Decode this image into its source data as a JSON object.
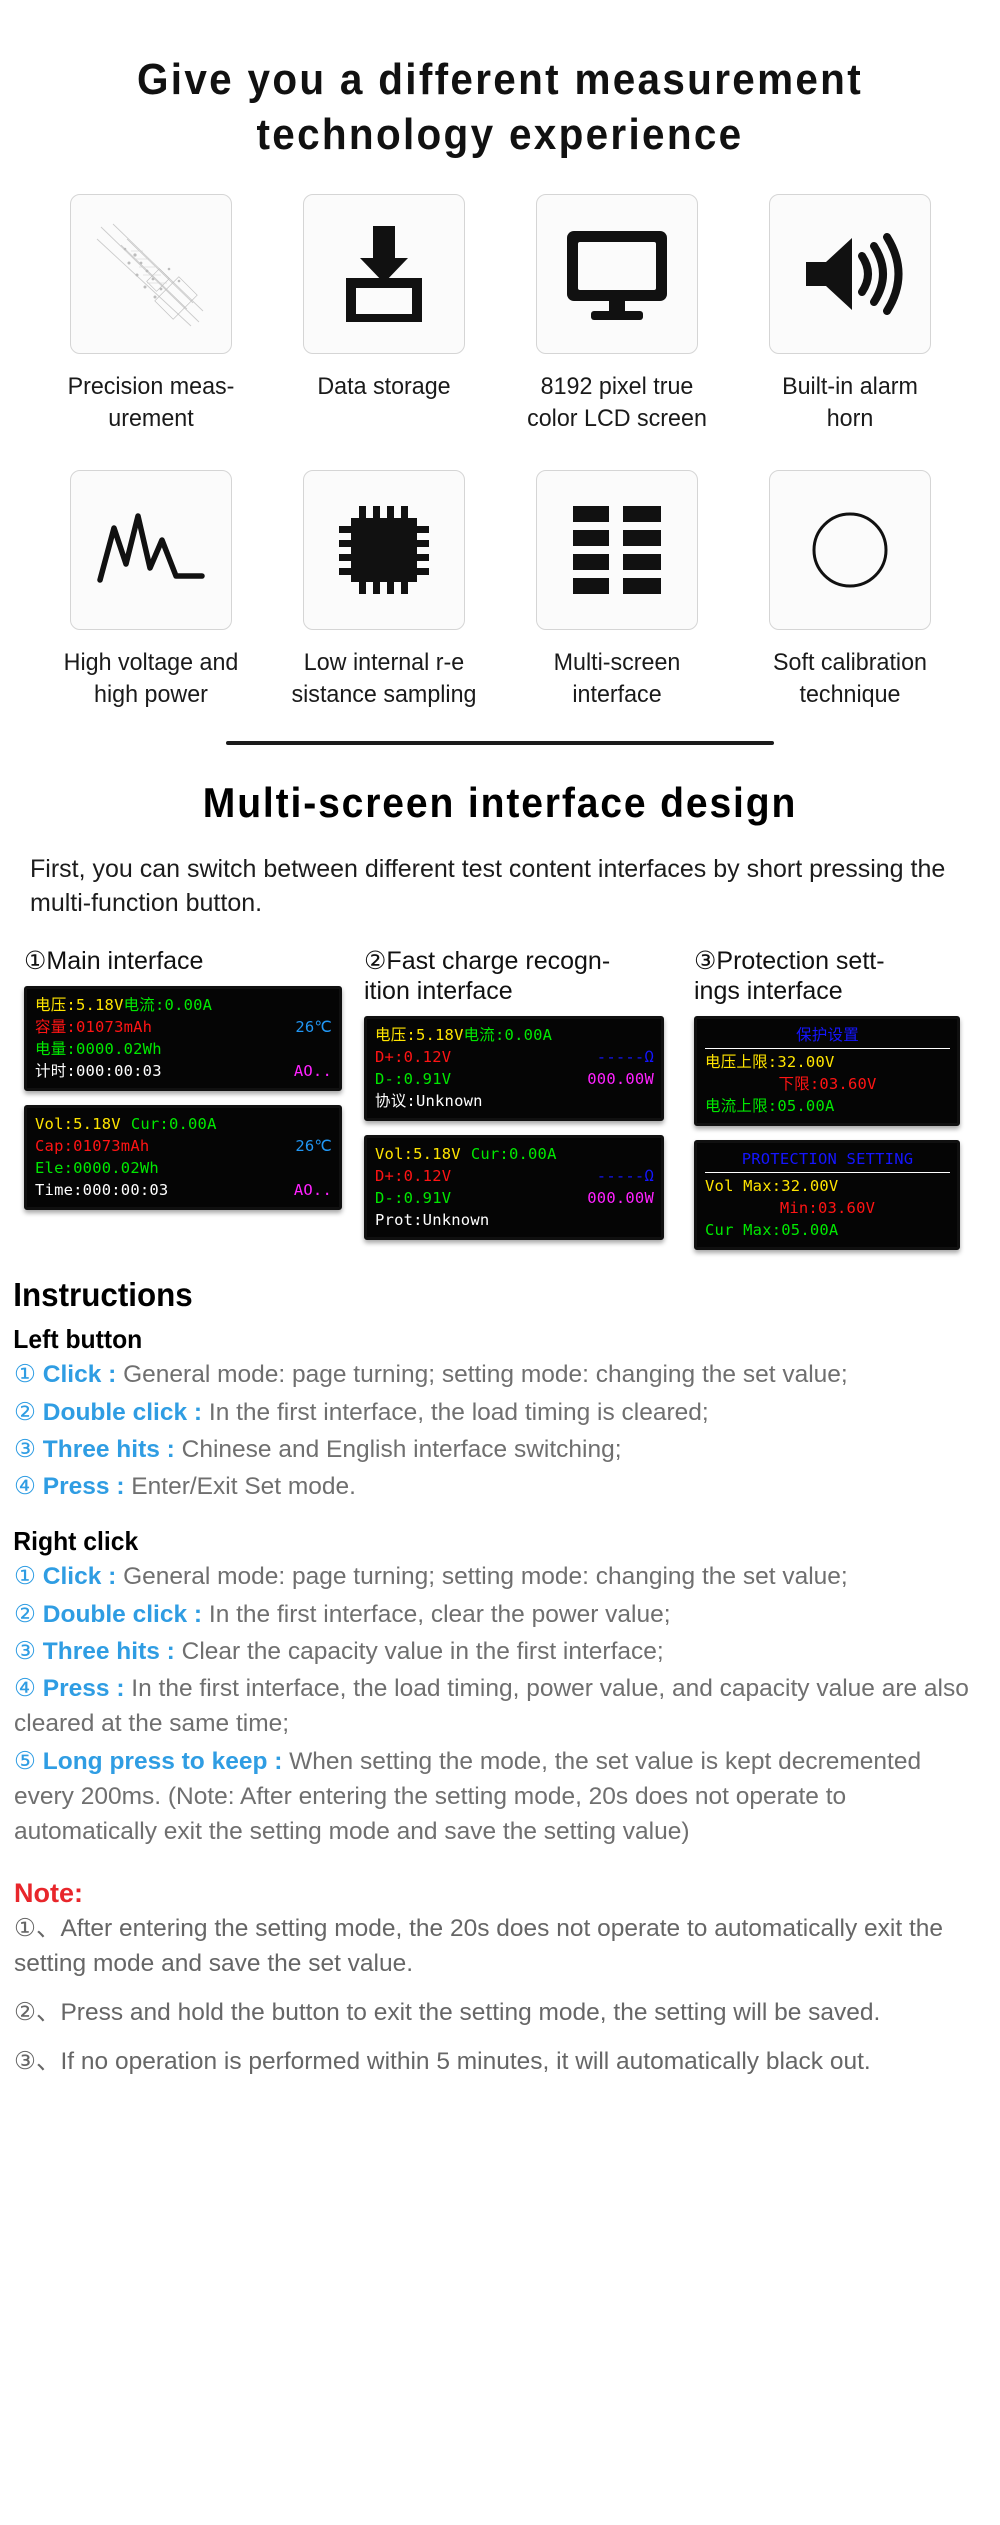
{
  "hero": {
    "title_line1": "Give you a different measurement",
    "title_line2": "technology experience"
  },
  "features": [
    {
      "icon": "precision-measurement-icon",
      "label": "Precision meas-\nurement"
    },
    {
      "icon": "data-storage-icon",
      "label": "Data storage"
    },
    {
      "icon": "lcd-screen-icon",
      "label": "8192 pixel true\ncolor LCD screen"
    },
    {
      "icon": "alarm-horn-icon",
      "label": "Built-in alarm\nhorn"
    },
    {
      "icon": "waveform-icon",
      "label": "High voltage and\nhigh power"
    },
    {
      "icon": "chip-icon",
      "label": "Low internal r-e\nsistance sampling"
    },
    {
      "icon": "multi-screen-grid-icon",
      "label": "Multi-screen\ninterface"
    },
    {
      "icon": "circle-calibration-icon",
      "label": "Soft calibration\ntechnique"
    }
  ],
  "section2": {
    "title": "Multi-screen  interface  design",
    "intro": "First, you can switch between different test content interfaces by short pressing the multi-function button."
  },
  "screens": [
    {
      "heading_num": "①",
      "heading_text": "Main interface",
      "cn": {
        "l1_left_label": "电压:",
        "l1_left_value": "5.18V",
        "l1_right_label": "电流:",
        "l1_right_value": "0.00A",
        "l2_label": "容量:",
        "l2_value": "01073mAh",
        "l2_temp": "26℃",
        "l3_label": "电量:",
        "l3_value": "0000.02Wh",
        "l4_label": "计时:",
        "l4_value": "000:00:03",
        "l4_mode": "AO.."
      },
      "en": {
        "l1_left_label": "Vol:",
        "l1_left_value": "5.18V",
        "l1_right_label": "Cur:",
        "l1_right_value": "0.00A",
        "l2_label": "Cap:",
        "l2_value": "01073mAh",
        "l2_temp": "26℃",
        "l3_label": "Ele:",
        "l3_value": "0000.02Wh",
        "l4_label": "Time:",
        "l4_value": "000:00:03",
        "l4_mode": "AO.."
      }
    },
    {
      "heading_num": "②",
      "heading_text": "Fast charge recogn-\n  ition interface",
      "cn": {
        "l1_left_label": "电压:",
        "l1_left_value": "5.18V",
        "l1_right_label": "电流:",
        "l1_right_value": "0.00A",
        "l2_label": "D+:",
        "l2_value": "0.12V",
        "l2_right": "-----Ω",
        "l3_label": "D-:",
        "l3_value": "0.91V",
        "l3_right": "000.00W",
        "l4_label": "协议:",
        "l4_value": "Unknown"
      },
      "en": {
        "l1_left_label": "Vol:",
        "l1_left_value": "5.18V",
        "l1_right_label": "Cur:",
        "l1_right_value": "0.00A",
        "l2_label": "D+:",
        "l2_value": "0.12V",
        "l2_right": "-----Ω",
        "l3_label": "D-:",
        "l3_value": "0.91V",
        "l3_right": "000.00W",
        "l4_label": "Prot:",
        "l4_value": "Unknown"
      }
    },
    {
      "heading_num": "③",
      "heading_text": "Protection sett-\n  ings interface",
      "cn": {
        "title": "保护设置",
        "l1": "电压上限:32.00V",
        "l2": "下限:03.60V",
        "l3": "电流上限:05.00A"
      },
      "en": {
        "title": "PROTECTION SETTING",
        "l1": "Vol Max:32.00V",
        "l2": "Min:03.60V",
        "l3": "Cur Max:05.00A"
      }
    }
  ],
  "instructions": {
    "title": "Instructions",
    "left_button": {
      "heading": "Left button",
      "items": [
        {
          "marker": "①",
          "key": "Click :",
          "text": " General mode: page turning; setting mode: changing the set value;"
        },
        {
          "marker": "②",
          "key": "Double click :",
          "text": " In the first interface, the load timing is cleared;"
        },
        {
          "marker": "③",
          "key": "Three hits :",
          "text": " Chinese and English interface switching;"
        },
        {
          "marker": "④",
          "key": "Press :",
          "text": " Enter/Exit Set mode."
        }
      ]
    },
    "right_click": {
      "heading": "Right click",
      "items": [
        {
          "marker": "①",
          "key": "Click :",
          "text": " General mode: page turning; setting mode: changing the set value;"
        },
        {
          "marker": "②",
          "key": "Double click :",
          "text": " In the first interface, clear the power value;"
        },
        {
          "marker": "③",
          "key": "Three hits :",
          "text": " Clear the capacity value in the first interface;"
        },
        {
          "marker": "④",
          "key": "Press :",
          "text": " In the first interface, the load timing, power value, and capacity value are also cleared at the same time;"
        },
        {
          "marker": "⑤",
          "key": "Long press to keep :",
          "text": " When setting the mode, the set value is kept decremented every 200ms. (Note: After entering the setting mode, 20s does not operate to automatically exit the setting mode and save the setting value)"
        }
      ]
    }
  },
  "note": {
    "title": "Note:",
    "items": [
      "①、After entering the setting mode, the 20s does not operate to automatically exit the setting mode and save the set value.",
      "②、Press and hold the button to exit the setting mode, the setting will be saved.",
      "③、If no operation is performed within 5 minutes, it will automatically black out."
    ]
  },
  "colors": {
    "accent_blue": "#2f9de3",
    "note_red": "#e8262b",
    "lcd_bg": "#050505",
    "lcd_yellow": "#ffe400",
    "lcd_green": "#00e800",
    "lcd_red": "#ff1414",
    "lcd_magenta": "#ff22ff",
    "lcd_blue": "#1515ff",
    "lcd_cyan": "#2196f3"
  }
}
